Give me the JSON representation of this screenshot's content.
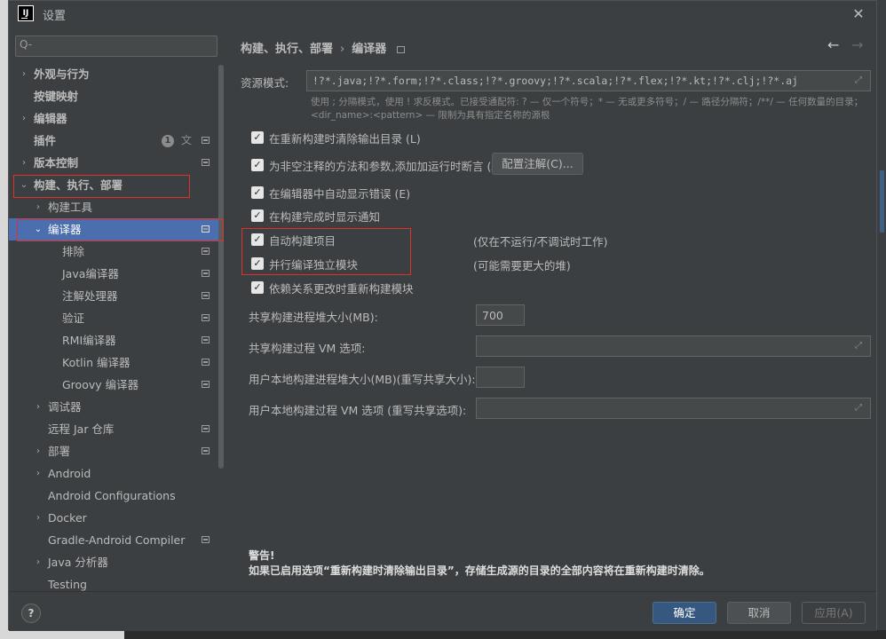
{
  "window": {
    "title": "设置"
  },
  "search": {
    "placeholder": "Q-"
  },
  "sidebar": {
    "items": [
      {
        "label": "外观与行为"
      },
      {
        "label": "按键映射"
      },
      {
        "label": "编辑器"
      },
      {
        "label": "插件",
        "badge": "1"
      },
      {
        "label": "版本控制"
      },
      {
        "label": "构建、执行、部署"
      },
      {
        "label": "构建工具"
      },
      {
        "label": "编译器"
      },
      {
        "label": "排除"
      },
      {
        "label": "Java编译器"
      },
      {
        "label": "注解处理器"
      },
      {
        "label": "验证"
      },
      {
        "label": "RMI编译器"
      },
      {
        "label": "Kotlin 编译器"
      },
      {
        "label": "Groovy 编译器"
      },
      {
        "label": "调试器"
      },
      {
        "label": "远程 Jar 仓库"
      },
      {
        "label": "部署"
      },
      {
        "label": "Android"
      },
      {
        "label": "Android Configurations"
      },
      {
        "label": "Docker"
      },
      {
        "label": "Gradle-Android Compiler"
      },
      {
        "label": "Java 分析器"
      },
      {
        "label": "Testing"
      }
    ]
  },
  "breadcrumb": {
    "parent": "构建、执行、部署",
    "separator": "›",
    "current": "编译器"
  },
  "resource": {
    "label": "资源模式:",
    "value": "!?*.java;!?*.form;!?*.class;!?*.groovy;!?*.scala;!?*.flex;!?*.kt;!?*.clj;!?*.aj",
    "hint": "使用 ; 分隔模式，使用 ! 求反模式。已接受通配符: ? — 仅一个符号；* — 无或更多符号；/ — 路径分隔符；/**/ — 任何数量的目录；<dir_name>:<pattern> — 限制为具有指定名称的源根"
  },
  "options": {
    "clear_output": "在重新构建时清除输出目录 (L)",
    "assertions": "为非空注释的方法和参数,添加加运行时断言 (A)",
    "configure_annotations": "配置注解(C)...",
    "show_errors": "在编辑器中自动显示错误 (E)",
    "notify": "在构建完成时显示通知",
    "auto_build": "自动构建项目",
    "auto_build_note": "(仅在不运行/不调试时工作)",
    "parallel": "并行编译独立模块",
    "parallel_note": "(可能需要更大的堆)",
    "rebuild_deps": "依赖关系更改时重新构建模块"
  },
  "heap": {
    "label": "共享构建进程堆大小(MB):",
    "value": "700"
  },
  "vm": {
    "label": "共享构建过程 VM 选项:"
  },
  "user_heap": {
    "label": "用户本地构建进程堆大小(MB)(重写共享大小):"
  },
  "user_vm": {
    "label": "用户本地构建过程 VM 选项 (重写共享选项):"
  },
  "warning": {
    "title": "警告!",
    "text": "如果已启用选项“重新构建时清除输出目录”，存储生成源的目录的全部内容将在重新构建时清除。"
  },
  "footer": {
    "help": "?",
    "ok": "确定",
    "cancel": "取消",
    "apply": "应用(A)"
  },
  "colors": {
    "accent": "#4b6eaf",
    "highlight_border": "#e0302a",
    "ok_button": "#365880"
  }
}
